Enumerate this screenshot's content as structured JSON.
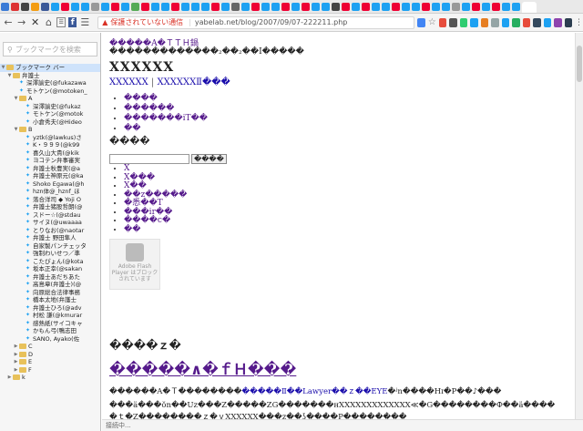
{
  "browser": {
    "security_warning": "保護されていない通信",
    "url": "yabelab.net/blog/2007/09/07-222211.php",
    "status": "接続中..."
  },
  "sidebar": {
    "search_placeholder": "ブックマークを検索",
    "root": "ブックマーク バー",
    "items": [
      {
        "label": "弁護士",
        "type": "folder",
        "level": 1,
        "open": true
      },
      {
        "label": "深澤諭史(@fukazawa",
        "type": "twitter",
        "level": 2
      },
      {
        "label": "モトケン(@motoken_",
        "type": "twitter",
        "level": 2
      },
      {
        "label": "A",
        "type": "folder",
        "level": 2,
        "open": true
      },
      {
        "label": "深澤諭史(@fukaz",
        "type": "twitter",
        "level": 3
      },
      {
        "label": "モトケン(@motok",
        "type": "twitter",
        "level": 3
      },
      {
        "label": "小倉秀夫(@Hideo",
        "type": "twitter",
        "level": 3
      },
      {
        "label": "B",
        "type": "folder",
        "level": 2,
        "open": true
      },
      {
        "label": "yztk(@lawkus)さ",
        "type": "twitter",
        "level": 3
      },
      {
        "label": "K・９９９(@k99",
        "type": "twitter",
        "level": 3
      },
      {
        "label": "喜久山大貴(@kik",
        "type": "twitter",
        "level": 3
      },
      {
        "label": "ヨコテン弁事審実",
        "type": "twitter",
        "level": 3
      },
      {
        "label": "弁護士秋豊実(@a",
        "type": "twitter",
        "level": 3
      },
      {
        "label": "弁護士神原元(@ka",
        "type": "twitter",
        "level": 3
      },
      {
        "label": "Shoko Egawa(@h",
        "type": "twitter",
        "level": 3
      },
      {
        "label": "hzn体@_hznf_ほ",
        "type": "twitter",
        "level": 3
      },
      {
        "label": "落合洋司 ◆ Yoji O",
        "type": "twitter",
        "level": 3
      },
      {
        "label": "弁護士猪股哲朗(@",
        "type": "twitter",
        "level": 3
      },
      {
        "label": "スドー☆(@stdau",
        "type": "twitter",
        "level": 3
      },
      {
        "label": "サイヌ(@uwaaaa",
        "type": "twitter",
        "level": 3
      },
      {
        "label": "とりなお(@naotar",
        "type": "twitter",
        "level": 3
      },
      {
        "label": "弁護士 野田隼人",
        "type": "twitter",
        "level": 3
      },
      {
        "label": "自家製パンチェッタ",
        "type": "twitter",
        "level": 3
      },
      {
        "label": "強制わいせつ／準",
        "type": "twitter",
        "level": 3
      },
      {
        "label": "こたぴょん(@kota",
        "type": "twitter",
        "level": 3
      },
      {
        "label": "坂本正幸(@sakan",
        "type": "twitter",
        "level": 3
      },
      {
        "label": "弁護士あだちあた",
        "type": "twitter",
        "level": 3
      },
      {
        "label": "高島章(弁護士)(@",
        "type": "twitter",
        "level": 3
      },
      {
        "label": "向原総合法律事務",
        "type": "twitter",
        "level": 3
      },
      {
        "label": "橋本太地(弁護士",
        "type": "twitter",
        "level": 3
      },
      {
        "label": "弁護士ひろ(@adv",
        "type": "twitter",
        "level": 3
      },
      {
        "label": "村松 謙(@kmurar",
        "type": "twitter",
        "level": 3
      },
      {
        "label": "感熱紙(サイコキャ",
        "type": "twitter",
        "level": 3
      },
      {
        "label": "かもん弓(鴨志田",
        "type": "twitter",
        "level": 3
      },
      {
        "label": "SANO, Ayako(佐",
        "type": "twitter",
        "level": 3
      },
      {
        "label": "C",
        "type": "folder",
        "level": 2,
        "open": false
      },
      {
        "label": "D",
        "type": "folder",
        "level": 2,
        "open": false
      },
      {
        "label": "E",
        "type": "folder",
        "level": 2,
        "open": false
      },
      {
        "label": "F",
        "type": "folder",
        "level": 2,
        "open": false
      },
      {
        "label": "k",
        "type": "folder",
        "level": 1,
        "open": false
      }
    ]
  },
  "page": {
    "title": "�����A�ＴＴＨ鍋",
    "subtitle": "�������������₂��₂��Ⅰ�����",
    "heading": "XXXXXX",
    "nav": [
      "XXXXXX",
      "XXXXXXⅡ���"
    ],
    "nav_sep": "|",
    "menu_links": [
      "����",
      "������",
      "�������iT��",
      "��"
    ],
    "section_heading": "����",
    "search_button": "����",
    "side_links": [
      "X",
      "X���",
      "X��",
      "��z�����",
      "�悉��T",
      "���ir��",
      "����c�",
      "��"
    ],
    "flash_title": "Adobe Flash Player はブロックされています",
    "heading2": "����ｚ�",
    "heading3": "�����∧�ｆＨ���",
    "para1_text": "������A�Ｔ��������",
    "para1_link": "�����Ⅱ��Lawyer��ｚ��EYE",
    "para1_rest": "�ʲn����Hɪ�P��♪���",
    "para2": "���ä���ŏn��Uz���Z�����ZG�������нXXXXXXXXXXXXX≪�G��������Ф��ä����",
    "para3": "�ｔ�Z��������ｚ�ｖXXXXXX���z��ʖ����P��������"
  }
}
